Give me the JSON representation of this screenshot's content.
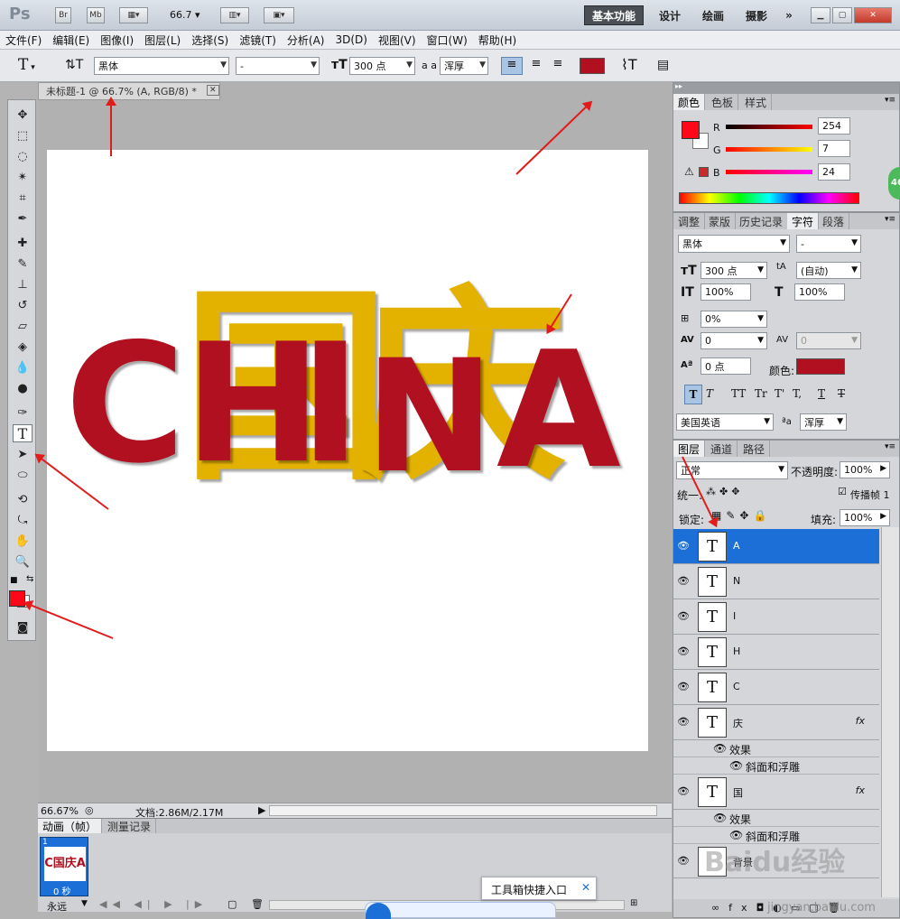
{
  "app": {
    "logo": "Ps",
    "bridge": "Br",
    "mini_bridge": "Mb",
    "zoom_box": "66.7"
  },
  "workspaces": [
    "基本功能",
    "设计",
    "绘画",
    "摄影",
    "»"
  ],
  "menu": [
    "文件(F)",
    "编辑(E)",
    "图像(I)",
    "图层(L)",
    "选择(S)",
    "滤镜(T)",
    "分析(A)",
    "3D(D)",
    "视图(V)",
    "窗口(W)",
    "帮助(H)"
  ],
  "options": {
    "tool_glyph": "T",
    "font_family": "黑体",
    "font_style": "-",
    "font_size": "300 点",
    "aa_label": "a a",
    "aa_mode": "浑厚",
    "text_color": "#b01020"
  },
  "document": {
    "tab_title": "未标题-1 @ 66.7% (A, RGB/8) *",
    "zoom": "66.67%",
    "doc_info": "文档:2.86M/2.17M"
  },
  "canvas_letters": [
    {
      "char": "国",
      "color": "#e3b100"
    },
    {
      "char": "庆",
      "color": "#e3b100"
    },
    {
      "char": "C",
      "color": "#b01020"
    },
    {
      "char": "H",
      "color": "#b01020"
    },
    {
      "char": "I",
      "color": "#b01020"
    },
    {
      "char": "N",
      "color": "#b01020"
    },
    {
      "char": "A",
      "color": "#b01020"
    }
  ],
  "color_panel": {
    "tabs": [
      "颜色",
      "色板",
      "样式"
    ],
    "r_label": "R",
    "g_label": "G",
    "b_label": "B",
    "r": "254",
    "g": "7",
    "b": "24",
    "fg_color": "#fe0718"
  },
  "char_panel": {
    "tabs": [
      "调整",
      "蒙版",
      "历史记录",
      "字符",
      "段落"
    ],
    "font_family": "黑体",
    "font_style": "-",
    "size": "300 点",
    "leading": "(自动)",
    "vscale": "100%",
    "hscale": "100%",
    "tracking_pct": "0%",
    "kerning": "0",
    "tracking": "0",
    "baseline": "0 点",
    "color_label": "颜色:",
    "color": "#b01020",
    "style_buttons": [
      "T",
      "T",
      "TT",
      "Tr",
      "T'",
      "T,",
      "T",
      "T"
    ],
    "language": "美国英语",
    "aa_mode": "浑厚"
  },
  "layers_panel": {
    "tabs": [
      "图层",
      "通道",
      "路径"
    ],
    "blend_mode": "正常",
    "opacity_label": "不透明度:",
    "opacity": "100%",
    "unify_label": "统一:",
    "propagate_label": "传播帧 1",
    "lock_label": "锁定:",
    "fill_label": "填充:",
    "fill": "100%",
    "layers": [
      {
        "name": "A",
        "selected": true
      },
      {
        "name": "N"
      },
      {
        "name": "I"
      },
      {
        "name": "H"
      },
      {
        "name": "C"
      },
      {
        "name": "庆",
        "fx": "fx",
        "effects_label": "效果",
        "effect": "斜面和浮雕"
      },
      {
        "name": "国",
        "fx": "fx",
        "effects_label": "效果",
        "effect": "斜面和浮雕"
      },
      {
        "name": "背景"
      }
    ]
  },
  "anim_panel": {
    "tabs": [
      "动画（帧）",
      "测量记录"
    ],
    "frame_number": "1",
    "frame_time": "0 秒",
    "loop": "永远"
  },
  "popup": {
    "label": "工具箱快捷入口",
    "close": "✕"
  },
  "watermark": {
    "brand": "Baidu经验",
    "url": "jingyan.baidu.com"
  },
  "side_badge": "46"
}
